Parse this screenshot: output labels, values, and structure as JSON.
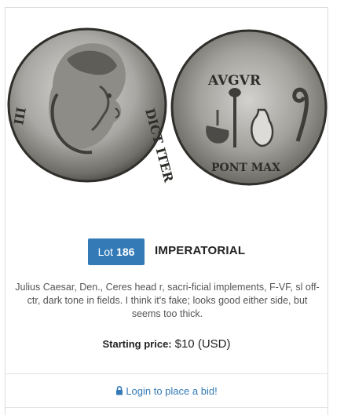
{
  "lot": {
    "label": "Lot",
    "number": "186",
    "category": "IMPERATORIAL"
  },
  "description": "Julius Caesar, Den., Ceres head r, sacri-ficial implements, F-VF, sl off-ctr, dark tone in fields. I think it's fake; looks good either side, but seems too thick.",
  "price": {
    "label": "Starting price:",
    "value": "$10 (USD)"
  },
  "coin": {
    "obverse_legend": "DICT ITER",
    "reverse_legend_top": "AVGVR",
    "reverse_legend_bottom": "PONT MAX"
  },
  "login": {
    "label": "Login to place a bid!",
    "icon": "lock-icon"
  },
  "colors": {
    "accent": "#337ab7"
  }
}
